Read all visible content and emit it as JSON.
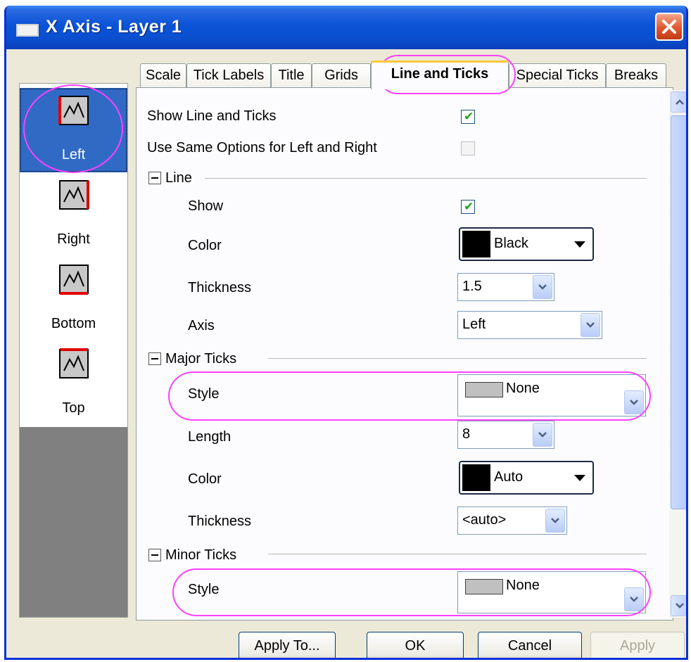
{
  "window": {
    "title": "X Axis - Layer 1"
  },
  "tabs": [
    {
      "label": "Scale"
    },
    {
      "label": "Tick Labels"
    },
    {
      "label": "Title"
    },
    {
      "label": "Grids"
    },
    {
      "label": "Line and Ticks",
      "active": true
    },
    {
      "label": "Special Ticks"
    },
    {
      "label": "Breaks"
    }
  ],
  "sidebar": {
    "items": [
      {
        "label": "Left",
        "icon": "axis-left-icon",
        "selected": true
      },
      {
        "label": "Right",
        "icon": "axis-right-icon"
      },
      {
        "label": "Bottom",
        "icon": "axis-bottom-icon"
      },
      {
        "label": "Top",
        "icon": "axis-top-icon"
      }
    ]
  },
  "options": {
    "show_line_and_ticks": {
      "label": "Show Line and Ticks",
      "checked": true
    },
    "same_options": {
      "label": "Use Same Options for Left and Right",
      "checked": false
    }
  },
  "line": {
    "header": "Line",
    "show": {
      "label": "Show",
      "checked": true
    },
    "color": {
      "label": "Color",
      "value": "Black",
      "swatch": "#000000"
    },
    "thickness": {
      "label": "Thickness",
      "value": "1.5"
    },
    "axis": {
      "label": "Axis",
      "value": "Left"
    }
  },
  "major_ticks": {
    "header": "Major Ticks",
    "style": {
      "label": "Style",
      "value": "None"
    },
    "length": {
      "label": "Length",
      "value": "8"
    },
    "color": {
      "label": "Color",
      "value": "Auto",
      "swatch": "#000000"
    },
    "thickness": {
      "label": "Thickness",
      "value": "<auto>"
    }
  },
  "minor_ticks": {
    "header": "Minor Ticks",
    "style": {
      "label": "Style",
      "value": "None"
    }
  },
  "buttons": {
    "apply_to": "Apply To...",
    "ok": "OK",
    "cancel": "Cancel",
    "apply": "Apply"
  },
  "colors": {
    "titlebar": "#0a53d6",
    "highlight": "#ff40ff",
    "selection": "#316ac5"
  }
}
